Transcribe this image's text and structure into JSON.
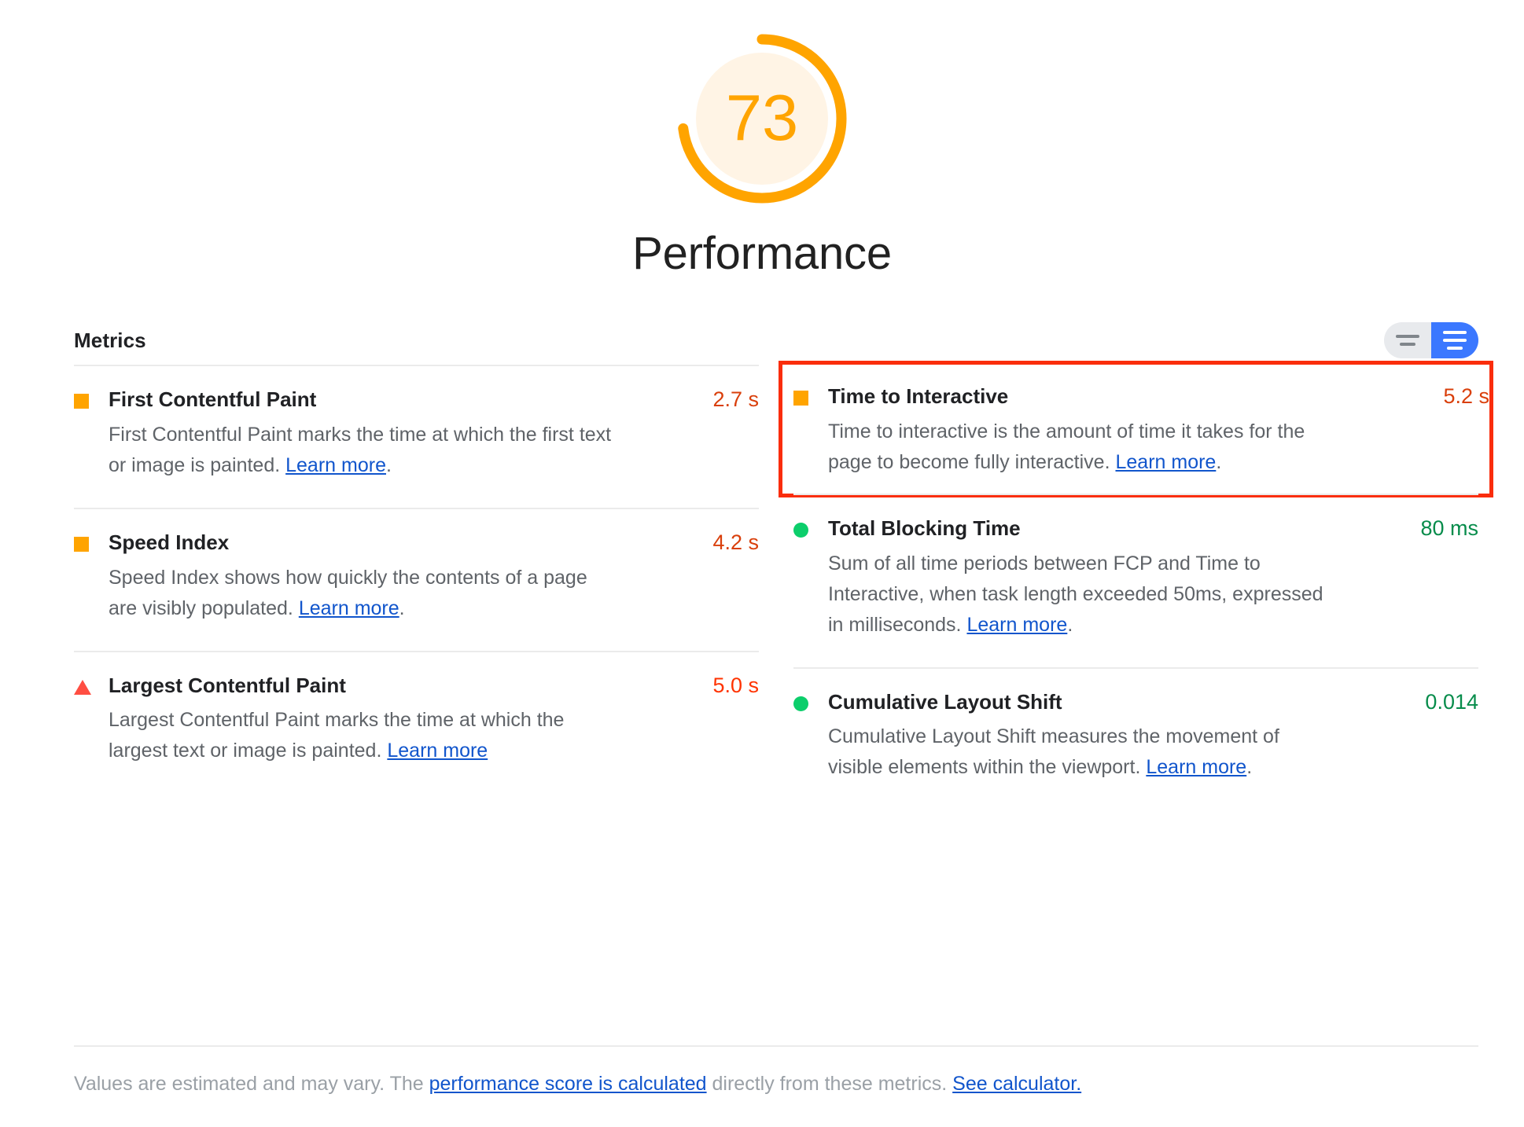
{
  "score": {
    "value": "73",
    "percent": 73,
    "title": "Performance",
    "arc_color": "#FFA400",
    "track_color": "#FFF4E5",
    "number_color": "#FFA400"
  },
  "metrics_section": {
    "heading": "Metrics",
    "toggle": {
      "name": "view-mode-toggle",
      "left_option": "simple-view",
      "right_option": "detailed-view",
      "selected": "detailed-view",
      "selected_color": "#3B78FF",
      "unselected_color": "#E8EAED"
    }
  },
  "metrics": [
    {
      "name": "First Contentful Paint",
      "value": "2.7 s",
      "rating": "average",
      "icon": "orange-square-icon",
      "description_before": "First Contentful Paint marks the time at which the first text or image is painted. ",
      "link_text": "Learn more",
      "description_after": ".",
      "highlighted": false
    },
    {
      "name": "Time to Interactive",
      "value": "5.2 s",
      "rating": "average",
      "icon": "orange-square-icon",
      "description_before": "Time to interactive is the amount of time it takes for the page to become fully interactive. ",
      "link_text": "Learn more",
      "description_after": ".",
      "highlighted": true
    },
    {
      "name": "Speed Index",
      "value": "4.2 s",
      "rating": "average",
      "icon": "orange-square-icon",
      "description_before": "Speed Index shows how quickly the contents of a page are visibly populated. ",
      "link_text": "Learn more",
      "description_after": ".",
      "highlighted": false
    },
    {
      "name": "Total Blocking Time",
      "value": "80 ms",
      "rating": "pass",
      "icon": "green-circle-icon",
      "description_before": "Sum of all time periods between FCP and Time to Interactive, when task length exceeded 50ms, expressed in milliseconds. ",
      "link_text": "Learn more",
      "description_after": ".",
      "highlighted": false
    },
    {
      "name": "Largest Contentful Paint",
      "value": "5.0 s",
      "rating": "fail",
      "icon": "red-triangle-icon",
      "description_before": "Largest Contentful Paint marks the time at which the largest text or image is painted. ",
      "link_text": "Learn more",
      "description_after": "",
      "highlighted": false
    },
    {
      "name": "Cumulative Layout Shift",
      "value": "0.014",
      "rating": "pass",
      "icon": "green-circle-icon",
      "description_before": "Cumulative Layout Shift measures the movement of visible elements within the viewport. ",
      "link_text": "Learn more",
      "description_after": ".",
      "highlighted": false
    }
  ],
  "footer": {
    "part1": "Values are estimated and may vary. The ",
    "link1": "performance score is calculated",
    "part2": " directly from these metrics. ",
    "link2": "See calculator."
  },
  "colors": {
    "pass": "#0CCE6B",
    "average": "#FFA400",
    "fail": "#FF4E42",
    "link": "#1155cc",
    "highlight_border": "#FA2D0C"
  }
}
